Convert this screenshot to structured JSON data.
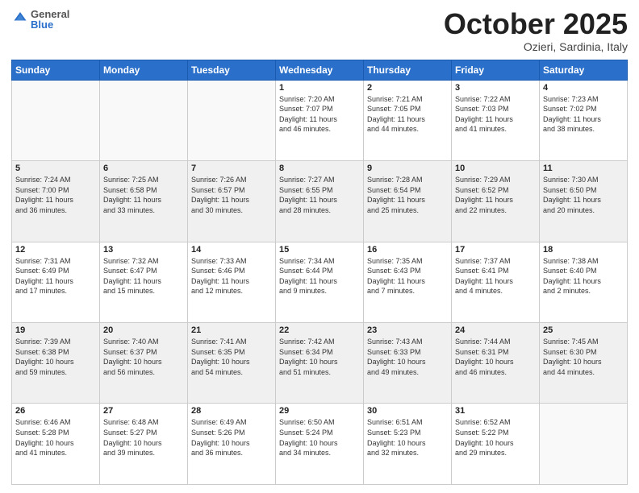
{
  "header": {
    "logo_general": "General",
    "logo_blue": "Blue",
    "title": "October 2025",
    "location": "Ozieri, Sardinia, Italy"
  },
  "columns": [
    "Sunday",
    "Monday",
    "Tuesday",
    "Wednesday",
    "Thursday",
    "Friday",
    "Saturday"
  ],
  "rows": [
    {
      "shaded": false,
      "cells": [
        {
          "day": "",
          "info": ""
        },
        {
          "day": "",
          "info": ""
        },
        {
          "day": "",
          "info": ""
        },
        {
          "day": "1",
          "info": "Sunrise: 7:20 AM\nSunset: 7:07 PM\nDaylight: 11 hours\nand 46 minutes."
        },
        {
          "day": "2",
          "info": "Sunrise: 7:21 AM\nSunset: 7:05 PM\nDaylight: 11 hours\nand 44 minutes."
        },
        {
          "day": "3",
          "info": "Sunrise: 7:22 AM\nSunset: 7:03 PM\nDaylight: 11 hours\nand 41 minutes."
        },
        {
          "day": "4",
          "info": "Sunrise: 7:23 AM\nSunset: 7:02 PM\nDaylight: 11 hours\nand 38 minutes."
        }
      ]
    },
    {
      "shaded": true,
      "cells": [
        {
          "day": "5",
          "info": "Sunrise: 7:24 AM\nSunset: 7:00 PM\nDaylight: 11 hours\nand 36 minutes."
        },
        {
          "day": "6",
          "info": "Sunrise: 7:25 AM\nSunset: 6:58 PM\nDaylight: 11 hours\nand 33 minutes."
        },
        {
          "day": "7",
          "info": "Sunrise: 7:26 AM\nSunset: 6:57 PM\nDaylight: 11 hours\nand 30 minutes."
        },
        {
          "day": "8",
          "info": "Sunrise: 7:27 AM\nSunset: 6:55 PM\nDaylight: 11 hours\nand 28 minutes."
        },
        {
          "day": "9",
          "info": "Sunrise: 7:28 AM\nSunset: 6:54 PM\nDaylight: 11 hours\nand 25 minutes."
        },
        {
          "day": "10",
          "info": "Sunrise: 7:29 AM\nSunset: 6:52 PM\nDaylight: 11 hours\nand 22 minutes."
        },
        {
          "day": "11",
          "info": "Sunrise: 7:30 AM\nSunset: 6:50 PM\nDaylight: 11 hours\nand 20 minutes."
        }
      ]
    },
    {
      "shaded": false,
      "cells": [
        {
          "day": "12",
          "info": "Sunrise: 7:31 AM\nSunset: 6:49 PM\nDaylight: 11 hours\nand 17 minutes."
        },
        {
          "day": "13",
          "info": "Sunrise: 7:32 AM\nSunset: 6:47 PM\nDaylight: 11 hours\nand 15 minutes."
        },
        {
          "day": "14",
          "info": "Sunrise: 7:33 AM\nSunset: 6:46 PM\nDaylight: 11 hours\nand 12 minutes."
        },
        {
          "day": "15",
          "info": "Sunrise: 7:34 AM\nSunset: 6:44 PM\nDaylight: 11 hours\nand 9 minutes."
        },
        {
          "day": "16",
          "info": "Sunrise: 7:35 AM\nSunset: 6:43 PM\nDaylight: 11 hours\nand 7 minutes."
        },
        {
          "day": "17",
          "info": "Sunrise: 7:37 AM\nSunset: 6:41 PM\nDaylight: 11 hours\nand 4 minutes."
        },
        {
          "day": "18",
          "info": "Sunrise: 7:38 AM\nSunset: 6:40 PM\nDaylight: 11 hours\nand 2 minutes."
        }
      ]
    },
    {
      "shaded": true,
      "cells": [
        {
          "day": "19",
          "info": "Sunrise: 7:39 AM\nSunset: 6:38 PM\nDaylight: 10 hours\nand 59 minutes."
        },
        {
          "day": "20",
          "info": "Sunrise: 7:40 AM\nSunset: 6:37 PM\nDaylight: 10 hours\nand 56 minutes."
        },
        {
          "day": "21",
          "info": "Sunrise: 7:41 AM\nSunset: 6:35 PM\nDaylight: 10 hours\nand 54 minutes."
        },
        {
          "day": "22",
          "info": "Sunrise: 7:42 AM\nSunset: 6:34 PM\nDaylight: 10 hours\nand 51 minutes."
        },
        {
          "day": "23",
          "info": "Sunrise: 7:43 AM\nSunset: 6:33 PM\nDaylight: 10 hours\nand 49 minutes."
        },
        {
          "day": "24",
          "info": "Sunrise: 7:44 AM\nSunset: 6:31 PM\nDaylight: 10 hours\nand 46 minutes."
        },
        {
          "day": "25",
          "info": "Sunrise: 7:45 AM\nSunset: 6:30 PM\nDaylight: 10 hours\nand 44 minutes."
        }
      ]
    },
    {
      "shaded": false,
      "cells": [
        {
          "day": "26",
          "info": "Sunrise: 6:46 AM\nSunset: 5:28 PM\nDaylight: 10 hours\nand 41 minutes."
        },
        {
          "day": "27",
          "info": "Sunrise: 6:48 AM\nSunset: 5:27 PM\nDaylight: 10 hours\nand 39 minutes."
        },
        {
          "day": "28",
          "info": "Sunrise: 6:49 AM\nSunset: 5:26 PM\nDaylight: 10 hours\nand 36 minutes."
        },
        {
          "day": "29",
          "info": "Sunrise: 6:50 AM\nSunset: 5:24 PM\nDaylight: 10 hours\nand 34 minutes."
        },
        {
          "day": "30",
          "info": "Sunrise: 6:51 AM\nSunset: 5:23 PM\nDaylight: 10 hours\nand 32 minutes."
        },
        {
          "day": "31",
          "info": "Sunrise: 6:52 AM\nSunset: 5:22 PM\nDaylight: 10 hours\nand 29 minutes."
        },
        {
          "day": "",
          "info": ""
        }
      ]
    }
  ]
}
